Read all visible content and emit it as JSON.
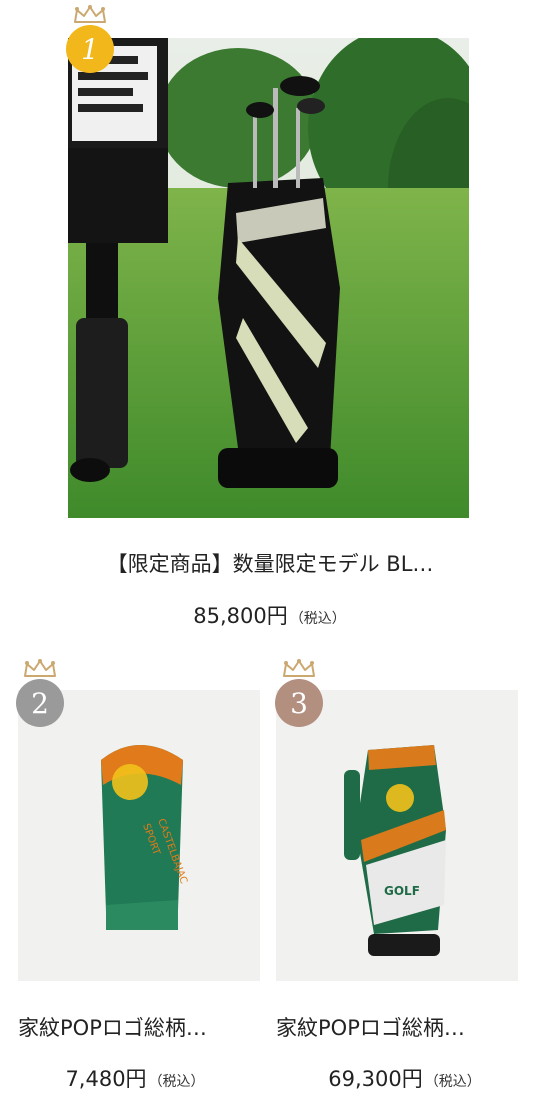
{
  "ranking": [
    {
      "rank": "1",
      "name": "【限定商品】数量限定モデル BL…",
      "price": "85,800円",
      "tax": "（税込）",
      "image_alt": "black and silver golf caddie bag on grass",
      "badge_color": "#f2b71b"
    },
    {
      "rank": "2",
      "name": "家紋POPロゴ総柄…",
      "price": "7,480円",
      "tax": "（税込）",
      "image_alt": "green headcover with logo",
      "badge_color": "#9a9a9a"
    },
    {
      "rank": "3",
      "name": "家紋POPロゴ総柄…",
      "price": "69,300円",
      "tax": "（税込）",
      "image_alt": "green and orange golf caddie bag",
      "badge_color": "#b38f80"
    }
  ],
  "icons": {
    "crown": "crown-icon",
    "crown_color": "#cba86f"
  }
}
